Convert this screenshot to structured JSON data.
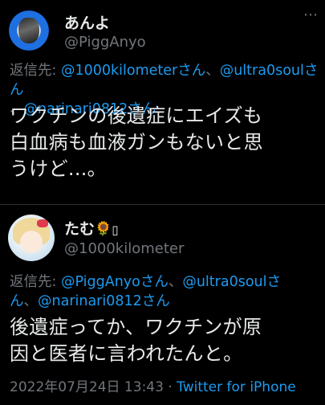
{
  "tweet1": {
    "display_name": "あんよ",
    "handle": "@PiggAnyo",
    "more_icon": "⋯",
    "reply_prefix": "返信先: ",
    "mentions": [
      "@1000kilometerさん",
      "@ultra0soulさん",
      "@narinari0812さん"
    ],
    "separator": "、",
    "body_lines": [
      "ワクチンの後遺症にエイズも",
      "白血病も血液ガンもないと思",
      "うけど...。"
    ]
  },
  "tweet2": {
    "display_name": "たむ",
    "name_emoji": "🌻",
    "name_extra": "▯",
    "handle": "@1000kilometer",
    "reply_prefix": "返信先: ",
    "mentions": [
      "@PiggAnyoさん",
      "@ultra0soulさ",
      "ん",
      "@narinari0812さん"
    ],
    "separator": "、",
    "body_lines": [
      "後遺症ってか、ワクチンが原",
      "因と医者に言われたんと。"
    ],
    "timestamp": "2022年07月24日 13:43",
    "dot": " · ",
    "source": "Twitter for iPhone"
  }
}
